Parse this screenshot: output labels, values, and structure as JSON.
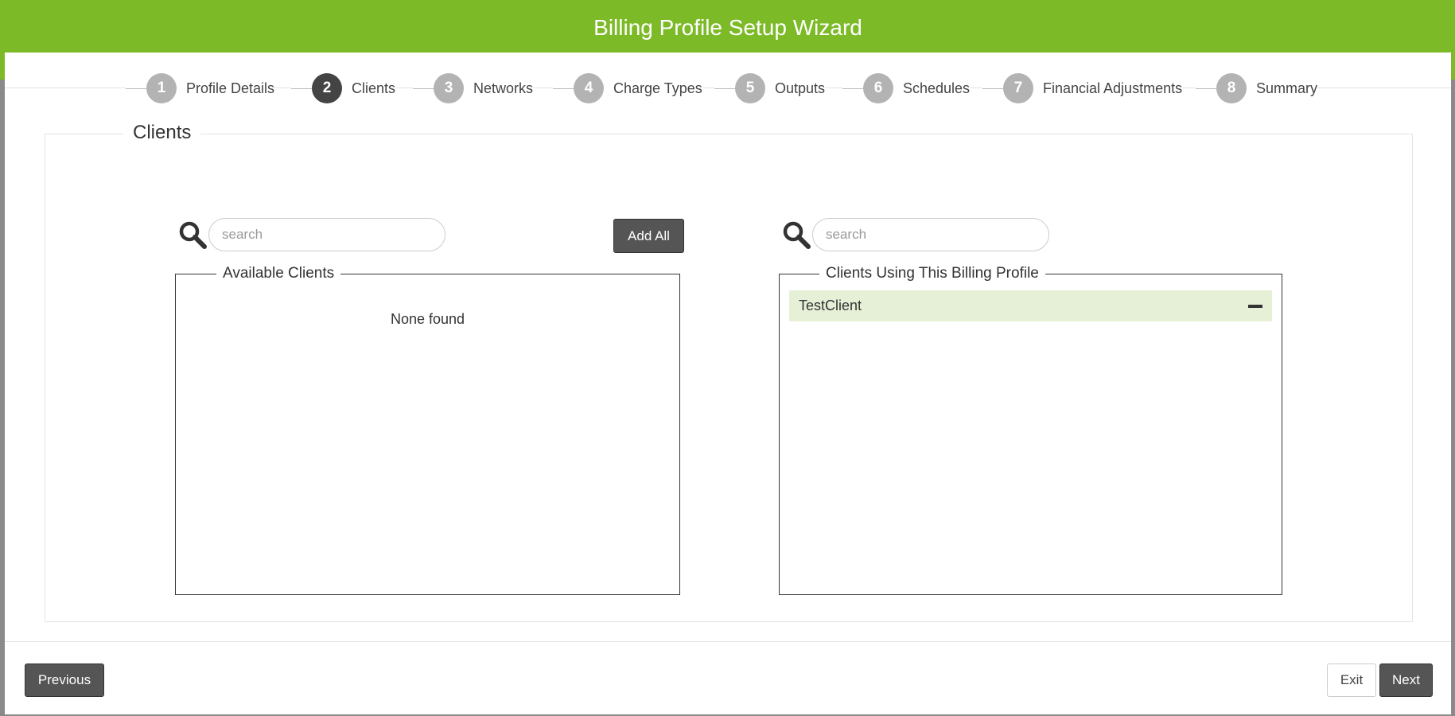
{
  "header": {
    "title": "Billing Profile Setup Wizard"
  },
  "steps": [
    {
      "num": "1",
      "label": "Profile Details"
    },
    {
      "num": "2",
      "label": "Clients"
    },
    {
      "num": "3",
      "label": "Networks"
    },
    {
      "num": "4",
      "label": "Charge Types"
    },
    {
      "num": "5",
      "label": "Outputs"
    },
    {
      "num": "6",
      "label": "Schedules"
    },
    {
      "num": "7",
      "label": "Financial Adjustments"
    },
    {
      "num": "8",
      "label": "Summary"
    }
  ],
  "active_step": 2,
  "section": {
    "title": "Clients"
  },
  "available": {
    "search_placeholder": "search",
    "add_all_label": "Add All",
    "legend": "Available Clients",
    "empty_text": "None found"
  },
  "assigned": {
    "search_placeholder": "search",
    "legend": "Clients Using This Billing Profile",
    "items": [
      {
        "name": "TestClient",
        "icon": "minus-icon"
      }
    ]
  },
  "footer": {
    "previous_label": "Previous",
    "exit_label": "Exit",
    "next_label": "Next"
  },
  "colors": {
    "accent": "#7dba28",
    "dark_button": "#555555",
    "row_highlight": "#e6f0d6"
  }
}
